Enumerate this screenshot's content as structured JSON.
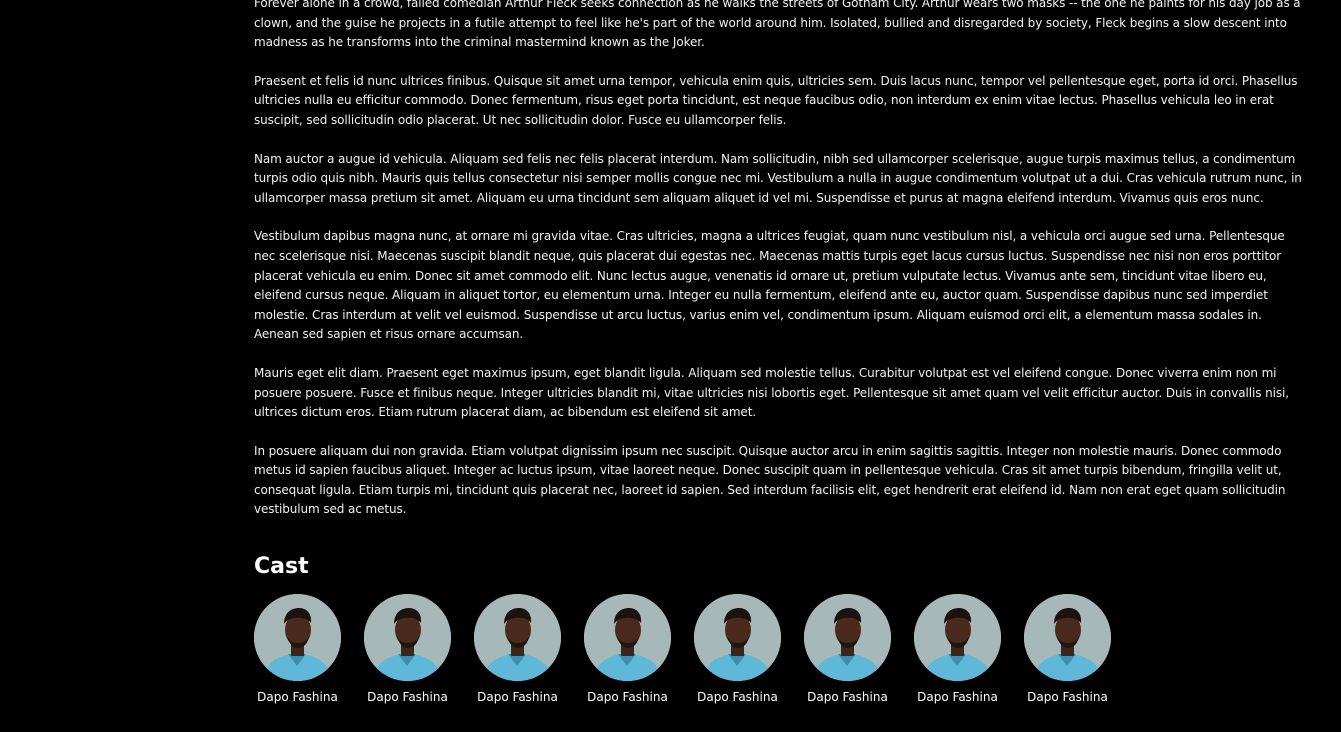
{
  "paragraphs": [
    "Forever alone in a crowd, failed comedian Arthur Fleck seeks connection as he walks the streets of Gotham City. Arthur wears two masks -- the one he paints for his day job as a clown, and the guise he projects in a futile attempt to feel like he's part of the world around him. Isolated, bullied and disregarded by society, Fleck begins a slow descent into madness as he transforms into the criminal mastermind known as the Joker.",
    "Praesent et felis id nunc ultrices finibus. Quisque sit amet urna tempor, vehicula enim quis, ultricies sem. Duis lacus nunc, tempor vel pellentesque eget, porta id orci. Phasellus ultricies nulla eu efficitur commodo. Donec fermentum, risus eget porta tincidunt, est neque faucibus odio, non interdum ex enim vitae lectus. Phasellus vehicula leo in erat suscipit, sed sollicitudin odio placerat. Ut nec sollicitudin dolor. Fusce eu ullamcorper felis.",
    "Nam auctor a augue id vehicula. Aliquam sed felis nec felis placerat interdum. Nam sollicitudin, nibh sed ullamcorper scelerisque, augue turpis maximus tellus, a condimentum turpis odio quis nibh. Mauris quis tellus consectetur nisi semper mollis congue nec mi. Vestibulum a nulla in augue condimentum volutpat ut a dui. Cras vehicula rutrum nunc, in ullamcorper massa pretium sit amet. Aliquam eu urna tincidunt sem aliquam aliquet id vel mi. Suspendisse et purus at magna eleifend interdum. Vivamus quis eros nunc.",
    "Vestibulum dapibus magna nunc, at ornare mi gravida vitae. Cras ultricies, magna a ultrices feugiat, quam nunc vestibulum nisl, a vehicula orci augue sed urna. Pellentesque nec scelerisque nisi. Maecenas suscipit blandit neque, quis placerat dui egestas nec. Maecenas mattis turpis eget lacus cursus luctus. Suspendisse nec nisi non eros porttitor placerat vehicula eu enim. Donec sit amet commodo elit. Nunc lectus augue, venenatis id ornare ut, pretium vulputate lectus. Vivamus ante sem, tincidunt vitae libero eu, eleifend cursus neque. Aliquam in aliquet tortor, eu elementum urna. Integer eu nulla fermentum, eleifend ante eu, auctor quam. Suspendisse dapibus nunc sed imperdiet molestie. Cras interdum at velit vel euismod. Suspendisse ut arcu luctus, varius enim vel, condimentum ipsum. Aliquam euismod orci elit, a elementum massa sodales in. Aenean sed sapien et risus ornare accumsan.",
    "Mauris eget elit diam. Praesent eget maximus ipsum, eget blandit ligula. Aliquam sed molestie tellus. Curabitur volutpat est vel eleifend congue. Donec viverra enim non mi posuere posuere. Fusce et finibus neque. Integer ultricies blandit mi, vitae ultricies nisi lobortis eget. Pellentesque sit amet quam vel velit efficitur auctor. Duis in convallis nisi, ultrices dictum eros. Etiam rutrum placerat diam, ac bibendum est eleifend sit amet.",
    "In posuere aliquam dui non gravida. Etiam volutpat dignissim ipsum nec suscipit. Quisque auctor arcu in enim sagittis sagittis. Integer non molestie mauris. Donec commodo metus id sapien faucibus aliquet. Integer ac luctus ipsum, vitae laoreet neque. Donec suscipit quam in pellentesque vehicula. Cras sit amet turpis bibendum, fringilla velit ut, consequat ligula. Etiam turpis mi, tincidunt quis placerat nec, laoreet id sapien. Sed interdum facilisis elit, eget hendrerit erat eleifend id. Nam non erat eget quam sollicitudin vestibulum sed ac metus."
  ],
  "cast": {
    "title": "Cast",
    "members": [
      {
        "name": "Dapo Fashina",
        "avatar_icon": "person-portrait-icon"
      },
      {
        "name": "Dapo Fashina",
        "avatar_icon": "person-portrait-icon"
      },
      {
        "name": "Dapo Fashina",
        "avatar_icon": "person-portrait-icon"
      },
      {
        "name": "Dapo Fashina",
        "avatar_icon": "person-portrait-icon"
      },
      {
        "name": "Dapo Fashina",
        "avatar_icon": "person-portrait-icon"
      },
      {
        "name": "Dapo Fashina",
        "avatar_icon": "person-portrait-icon"
      },
      {
        "name": "Dapo Fashina",
        "avatar_icon": "person-portrait-icon"
      },
      {
        "name": "Dapo Fashina",
        "avatar_icon": "person-portrait-icon"
      }
    ]
  },
  "colors": {
    "background": "#000000",
    "text": "#ffffff",
    "avatar_bg": "#9fb3b2",
    "shirt": "#5fb8d8",
    "skin": "#4a2a1c"
  }
}
